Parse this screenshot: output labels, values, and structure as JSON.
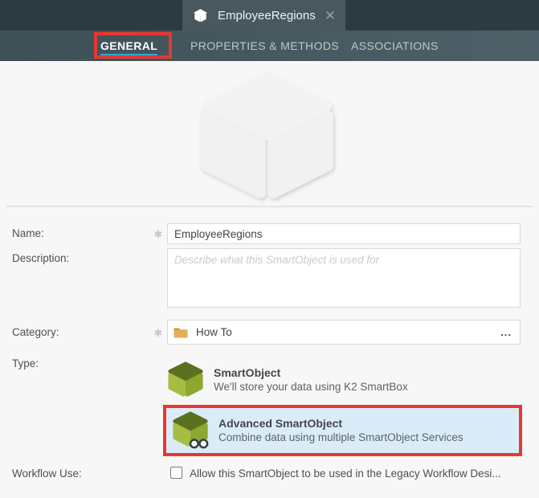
{
  "window": {
    "tab_title": "EmployeeRegions",
    "close_glyph": "✕"
  },
  "nav": {
    "tabs": [
      {
        "label": "GENERAL",
        "active": true
      },
      {
        "label": "PROPERTIES & METHODS",
        "active": false
      },
      {
        "label": "ASSOCIATIONS",
        "active": false
      }
    ]
  },
  "form": {
    "name": {
      "label": "Name:",
      "required_glyph": "✱",
      "value": "EmployeeRegions"
    },
    "description": {
      "label": "Description:",
      "placeholder": "Describe what this SmartObject is used for"
    },
    "category": {
      "label": "Category:",
      "required_glyph": "✱",
      "value": "How To",
      "browse_label": "..."
    },
    "type": {
      "label": "Type:",
      "options": [
        {
          "title": "SmartObject",
          "description": "We'll store your data using K2 SmartBox",
          "selected": false
        },
        {
          "title": "Advanced SmartObject",
          "description": "Combine data using multiple SmartObject Services",
          "selected": true
        }
      ]
    },
    "workflow": {
      "label": "Workflow Use:",
      "checkbox_label": "Allow this SmartObject to be used in the Legacy Workflow Desi...",
      "checked": false
    }
  },
  "colors": {
    "titlebar": "#2d3b41",
    "navbar": "#45585f",
    "active_underline": "#29abe2",
    "annotation_red": "#e8382e",
    "selected_option_bg": "#dbecf9",
    "smartobject_green_top": "#5c7120",
    "smartobject_green_left": "#a6bc43",
    "smartobject_green_right": "#8da72f",
    "folder_orange": "#e3a54f"
  }
}
